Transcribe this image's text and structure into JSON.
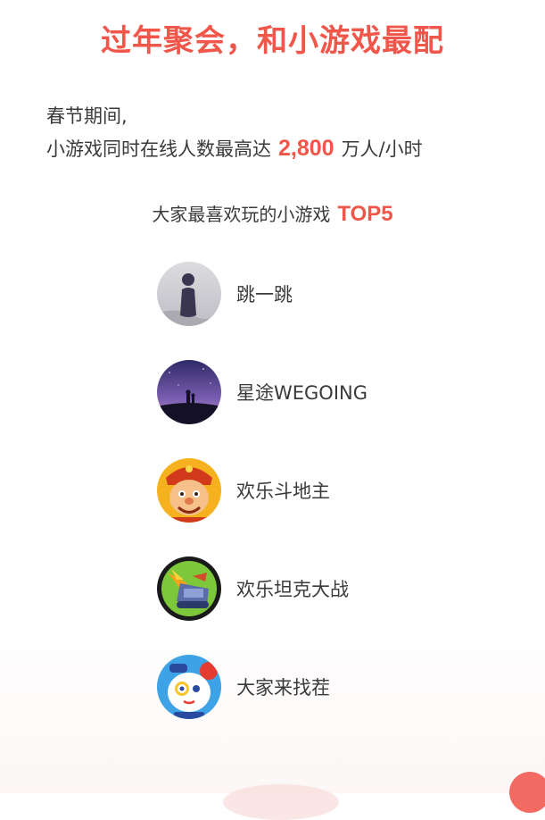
{
  "header": {
    "title": "过年聚会，和小游戏最配"
  },
  "intro": {
    "line1": "春节期间,",
    "line2_prefix": "小游戏同时在线人数最高达",
    "peak_value": "2,800",
    "line2_suffix": "万人/小时"
  },
  "ranking": {
    "heading": "大家最喜欢玩的小游戏",
    "heading_highlight": "TOP5",
    "games": [
      {
        "name": "跳一跳"
      },
      {
        "name": "星途WEGOING"
      },
      {
        "name": "欢乐斗地主"
      },
      {
        "name": "欢乐坦克大战"
      },
      {
        "name": "大家来找茬"
      }
    ]
  },
  "colors": {
    "accent": "#f0574a",
    "text": "#3a3a3a"
  }
}
